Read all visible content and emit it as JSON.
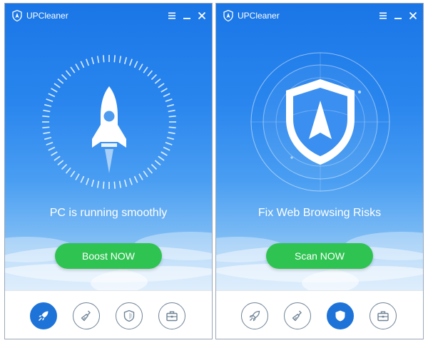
{
  "windows": [
    {
      "app_title": "UPCleaner",
      "status_text": "PC is running smoothly",
      "action_label": "Boost NOW",
      "hero_icon": "rocket-icon",
      "active_nav": "boost",
      "nav": [
        "rocket-icon",
        "broom-icon",
        "shield-icon",
        "toolbox-icon"
      ]
    },
    {
      "app_title": "UPCleaner",
      "status_text": "Fix Web Browsing Risks",
      "action_label": "Scan NOW",
      "hero_icon": "shield-icon",
      "active_nav": "protect",
      "nav": [
        "rocket-icon",
        "broom-icon",
        "shield-icon",
        "toolbox-icon"
      ]
    }
  ],
  "colors": {
    "sky_top": "#1a76e6",
    "action_button": "#2fc452",
    "nav_active": "#1e73d8",
    "nav_icon": "#6f8396"
  }
}
